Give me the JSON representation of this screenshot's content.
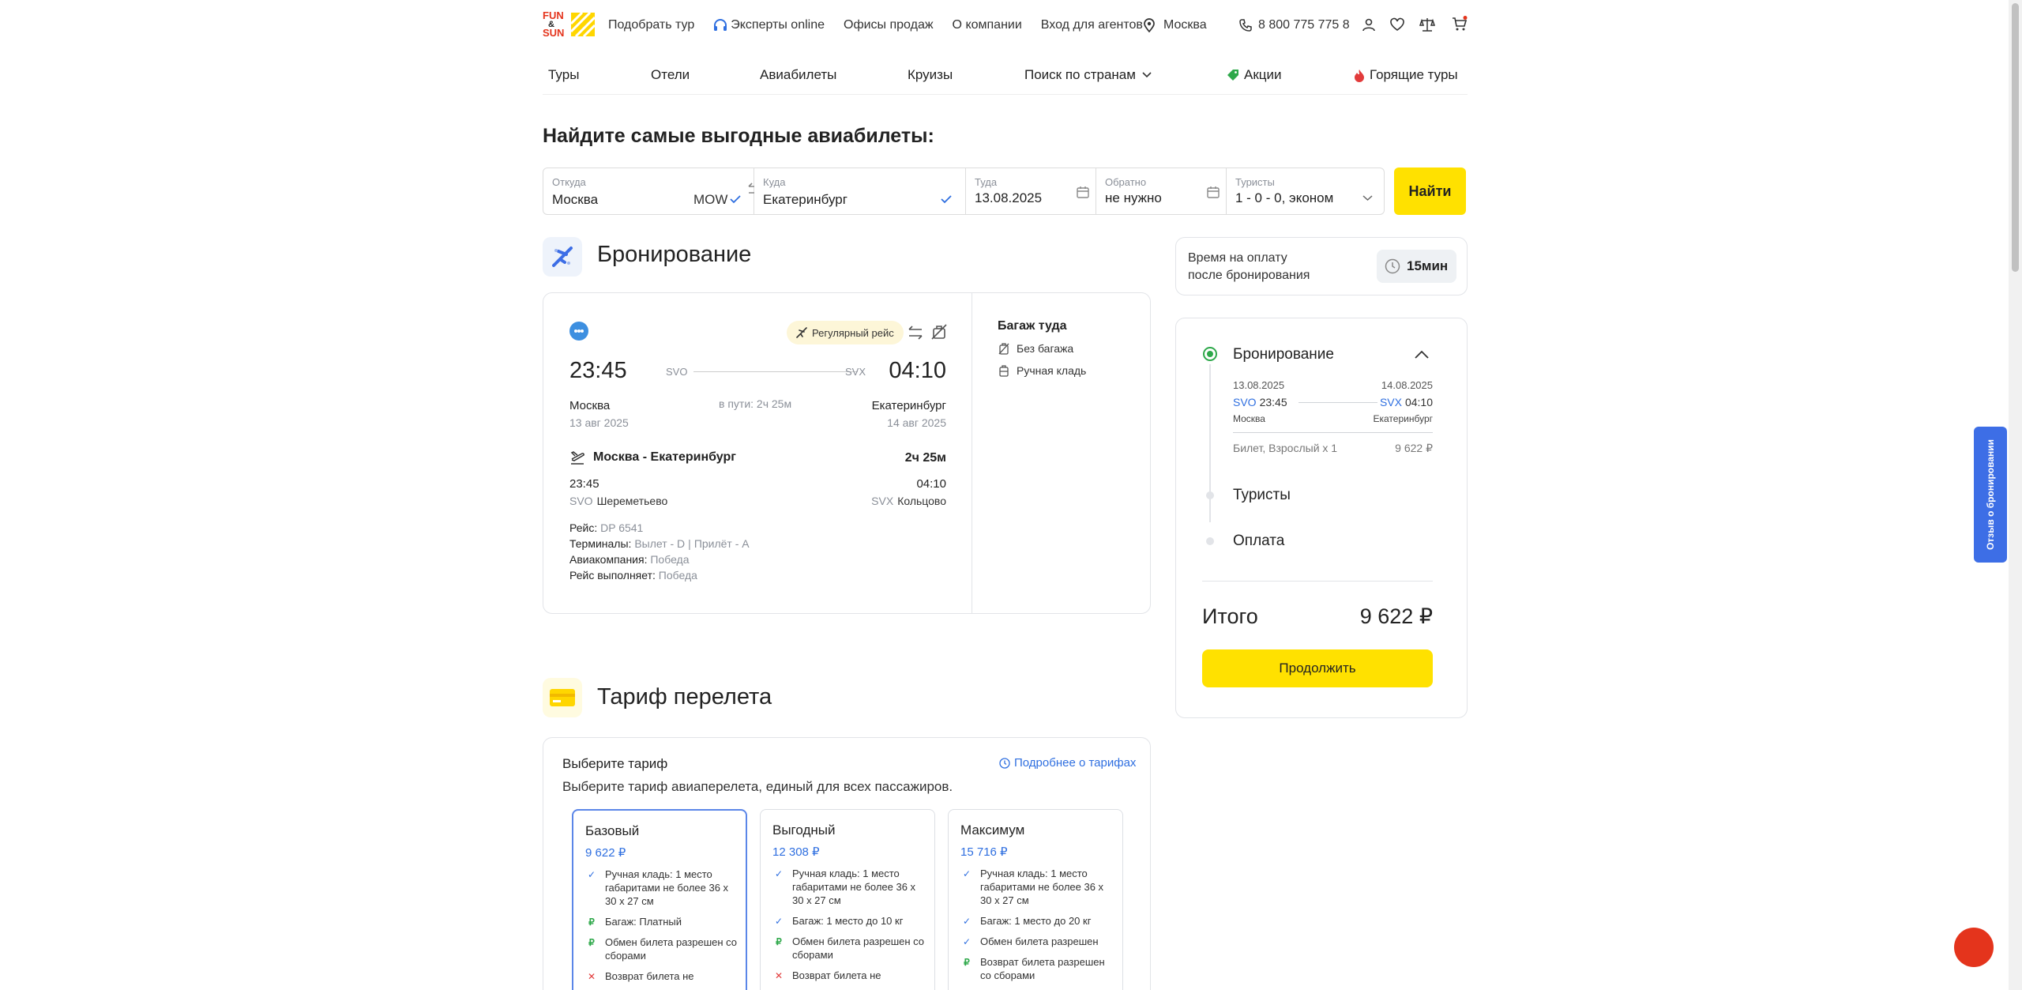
{
  "logo": {
    "line1": "FUN",
    "amp": "&",
    "line2": "SUN"
  },
  "topnav": {
    "items": [
      "Подобрать тур",
      "Эксперты online",
      "Офисы продаж",
      "О компании",
      "Вход для агентов"
    ],
    "city": "Москва",
    "phone": "8 800 775 775 8"
  },
  "secnav": {
    "items": [
      "Туры",
      "Отели",
      "Авиабилеты",
      "Круизы",
      "Поиск по странам",
      "Акции",
      "Горящие туры"
    ]
  },
  "search": {
    "heading": "Найдите самые выгодные авиабилеты:",
    "from_label": "Откуда",
    "from_value": "Москва",
    "from_code": "MOW",
    "to_label": "Куда",
    "to_value": "Екатеринбург",
    "depart_label": "Туда",
    "depart_value": "13.08.2025",
    "return_label": "Обратно",
    "return_value": "не нужно",
    "tourists_label": "Туристы",
    "tourists_value": "1 - 0 - 0, эконом",
    "submit": "Найти"
  },
  "booking": {
    "heading": "Бронирование",
    "regular_badge": "Регулярный рейс",
    "dep_time": "23:45",
    "arr_time": "04:10",
    "dep_code": "SVO",
    "arr_code": "SVX",
    "dep_city": "Москва",
    "arr_city": "Екатеринбург",
    "dep_date": "13 авг 2025",
    "arr_date": "14 авг 2025",
    "duration_text": "в пути: 2ч 25м",
    "route": "Москва - Екатеринбург",
    "route_duration": "2ч 25м",
    "seg_dep_time": "23:45",
    "seg_arr_time": "04:10",
    "seg_dep_code": "SVO",
    "seg_dep_airport": "Шереметьево",
    "seg_arr_code": "SVX",
    "seg_arr_airport": "Кольцово",
    "flight_label": "Рейс:",
    "flight_value": "DP 6541",
    "terminals_label": "Терминалы:",
    "terminals_dep": "Вылет - D",
    "terminals_arr": "Прилёт - A",
    "airline_label": "Авиакомпания:",
    "airline_value": "Победа",
    "operator_label": "Рейс выполняет:",
    "operator_value": "Победа",
    "baggage_title": "Багаж туда",
    "no_baggage": "Без багажа",
    "hand_luggage": "Ручная кладь"
  },
  "tariff": {
    "heading": "Тариф перелета",
    "choose_title": "Выберите тариф",
    "more_link": "Подробнее о тарифах",
    "subtitle": "Выберите тариф авиаперелета, единый для всех пассажиров.",
    "fares": [
      {
        "name": "Базовый",
        "price": "9 622 ₽",
        "selected": true,
        "features": [
          {
            "icon": "check",
            "text": "Ручная кладь: 1 место габаритами не более 36 х 30 х 27 см"
          },
          {
            "icon": "ruble",
            "text": "Багаж: Платный"
          },
          {
            "icon": "ruble",
            "text": "Обмен билета разрешен со сборами"
          },
          {
            "icon": "cross",
            "text": "Возврат билета не"
          }
        ]
      },
      {
        "name": "Выгодный",
        "price": "12 308 ₽",
        "selected": false,
        "features": [
          {
            "icon": "check",
            "text": "Ручная кладь: 1 место габаритами не более 36 х 30 х 27 см"
          },
          {
            "icon": "check",
            "text": "Багаж: 1 место до 10 кг"
          },
          {
            "icon": "ruble",
            "text": "Обмен билета разрешен со сборами"
          },
          {
            "icon": "cross",
            "text": "Возврат билета не"
          }
        ]
      },
      {
        "name": "Максимум",
        "price": "15 716 ₽",
        "selected": false,
        "features": [
          {
            "icon": "check",
            "text": "Ручная кладь: 1 место габаритами не более 36 х 30 х 27 см"
          },
          {
            "icon": "check",
            "text": "Багаж: 1 место до 20 кг"
          },
          {
            "icon": "check",
            "text": "Обмен билета разрешен"
          },
          {
            "icon": "ruble",
            "text": "Возврат билета разрешен со сборами"
          }
        ]
      }
    ]
  },
  "timer": {
    "label_line1": "Время на оплату",
    "label_line2": "после бронирования",
    "value": "15мин"
  },
  "summary": {
    "step1": "Бронирование",
    "dep_date": "13.08.2025",
    "arr_date": "14.08.2025",
    "dep_code": "SVO",
    "dep_time": "23:45",
    "arr_code": "SVX",
    "arr_time": "04:10",
    "dep_city": "Москва",
    "arr_city": "Екатеринбург",
    "ticket_label": "Билет, Взрослый x 1",
    "ticket_price": "9 622 ₽",
    "step2": "Туристы",
    "step3": "Оплата",
    "total_label": "Итого",
    "total_value": "9 622 ₽",
    "continue": "Продолжить"
  },
  "feedback_tab": "Отзыв о бронировании",
  "colors": {
    "accent": "#ffe100",
    "link": "#2f6fe0",
    "success": "#2ea84a",
    "danger": "#e23b3b",
    "feedback": "#3d6ee6"
  }
}
